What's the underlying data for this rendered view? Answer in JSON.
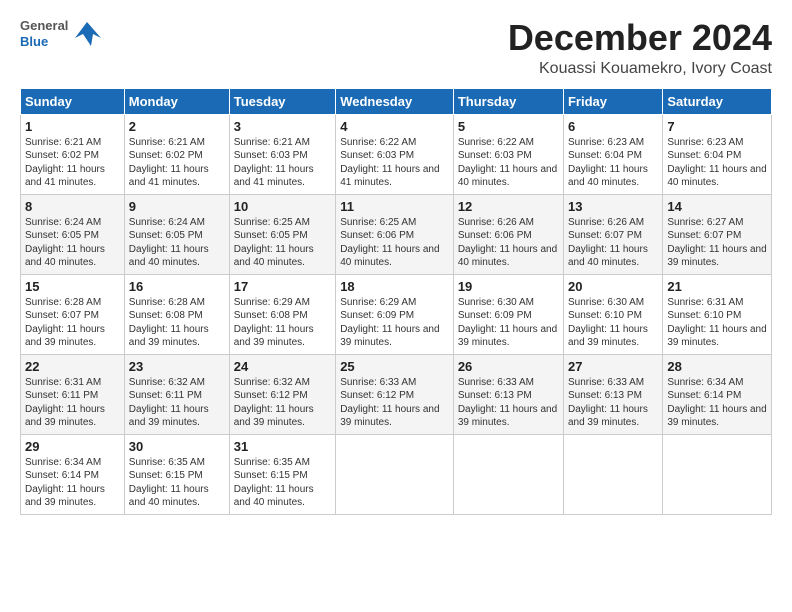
{
  "logo": {
    "general": "General",
    "blue": "Blue"
  },
  "title": "December 2024",
  "subtitle": "Kouassi Kouamekro, Ivory Coast",
  "headers": [
    "Sunday",
    "Monday",
    "Tuesday",
    "Wednesday",
    "Thursday",
    "Friday",
    "Saturday"
  ],
  "weeks": [
    [
      {
        "day": "1",
        "sunrise": "6:21 AM",
        "sunset": "6:02 PM",
        "daylight": "11 hours and 41 minutes."
      },
      {
        "day": "2",
        "sunrise": "6:21 AM",
        "sunset": "6:02 PM",
        "daylight": "11 hours and 41 minutes."
      },
      {
        "day": "3",
        "sunrise": "6:21 AM",
        "sunset": "6:03 PM",
        "daylight": "11 hours and 41 minutes."
      },
      {
        "day": "4",
        "sunrise": "6:22 AM",
        "sunset": "6:03 PM",
        "daylight": "11 hours and 41 minutes."
      },
      {
        "day": "5",
        "sunrise": "6:22 AM",
        "sunset": "6:03 PM",
        "daylight": "11 hours and 40 minutes."
      },
      {
        "day": "6",
        "sunrise": "6:23 AM",
        "sunset": "6:04 PM",
        "daylight": "11 hours and 40 minutes."
      },
      {
        "day": "7",
        "sunrise": "6:23 AM",
        "sunset": "6:04 PM",
        "daylight": "11 hours and 40 minutes."
      }
    ],
    [
      {
        "day": "8",
        "sunrise": "6:24 AM",
        "sunset": "6:05 PM",
        "daylight": "11 hours and 40 minutes."
      },
      {
        "day": "9",
        "sunrise": "6:24 AM",
        "sunset": "6:05 PM",
        "daylight": "11 hours and 40 minutes."
      },
      {
        "day": "10",
        "sunrise": "6:25 AM",
        "sunset": "6:05 PM",
        "daylight": "11 hours and 40 minutes."
      },
      {
        "day": "11",
        "sunrise": "6:25 AM",
        "sunset": "6:06 PM",
        "daylight": "11 hours and 40 minutes."
      },
      {
        "day": "12",
        "sunrise": "6:26 AM",
        "sunset": "6:06 PM",
        "daylight": "11 hours and 40 minutes."
      },
      {
        "day": "13",
        "sunrise": "6:26 AM",
        "sunset": "6:07 PM",
        "daylight": "11 hours and 40 minutes."
      },
      {
        "day": "14",
        "sunrise": "6:27 AM",
        "sunset": "6:07 PM",
        "daylight": "11 hours and 39 minutes."
      }
    ],
    [
      {
        "day": "15",
        "sunrise": "6:28 AM",
        "sunset": "6:07 PM",
        "daylight": "11 hours and 39 minutes."
      },
      {
        "day": "16",
        "sunrise": "6:28 AM",
        "sunset": "6:08 PM",
        "daylight": "11 hours and 39 minutes."
      },
      {
        "day": "17",
        "sunrise": "6:29 AM",
        "sunset": "6:08 PM",
        "daylight": "11 hours and 39 minutes."
      },
      {
        "day": "18",
        "sunrise": "6:29 AM",
        "sunset": "6:09 PM",
        "daylight": "11 hours and 39 minutes."
      },
      {
        "day": "19",
        "sunrise": "6:30 AM",
        "sunset": "6:09 PM",
        "daylight": "11 hours and 39 minutes."
      },
      {
        "day": "20",
        "sunrise": "6:30 AM",
        "sunset": "6:10 PM",
        "daylight": "11 hours and 39 minutes."
      },
      {
        "day": "21",
        "sunrise": "6:31 AM",
        "sunset": "6:10 PM",
        "daylight": "11 hours and 39 minutes."
      }
    ],
    [
      {
        "day": "22",
        "sunrise": "6:31 AM",
        "sunset": "6:11 PM",
        "daylight": "11 hours and 39 minutes."
      },
      {
        "day": "23",
        "sunrise": "6:32 AM",
        "sunset": "6:11 PM",
        "daylight": "11 hours and 39 minutes."
      },
      {
        "day": "24",
        "sunrise": "6:32 AM",
        "sunset": "6:12 PM",
        "daylight": "11 hours and 39 minutes."
      },
      {
        "day": "25",
        "sunrise": "6:33 AM",
        "sunset": "6:12 PM",
        "daylight": "11 hours and 39 minutes."
      },
      {
        "day": "26",
        "sunrise": "6:33 AM",
        "sunset": "6:13 PM",
        "daylight": "11 hours and 39 minutes."
      },
      {
        "day": "27",
        "sunrise": "6:33 AM",
        "sunset": "6:13 PM",
        "daylight": "11 hours and 39 minutes."
      },
      {
        "day": "28",
        "sunrise": "6:34 AM",
        "sunset": "6:14 PM",
        "daylight": "11 hours and 39 minutes."
      }
    ],
    [
      {
        "day": "29",
        "sunrise": "6:34 AM",
        "sunset": "6:14 PM",
        "daylight": "11 hours and 39 minutes."
      },
      {
        "day": "30",
        "sunrise": "6:35 AM",
        "sunset": "6:15 PM",
        "daylight": "11 hours and 40 minutes."
      },
      {
        "day": "31",
        "sunrise": "6:35 AM",
        "sunset": "6:15 PM",
        "daylight": "11 hours and 40 minutes."
      },
      null,
      null,
      null,
      null
    ]
  ],
  "labels": {
    "sunrise": "Sunrise:",
    "sunset": "Sunset:",
    "daylight": "Daylight:"
  }
}
